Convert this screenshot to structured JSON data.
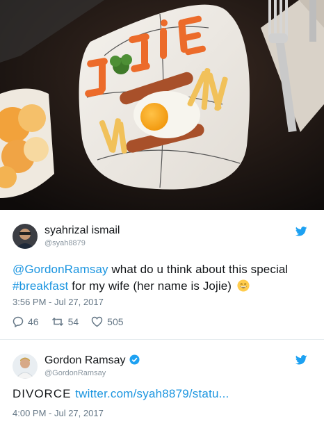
{
  "photo": {
    "plate_text": "Jojie",
    "description_icon": "breakfast-plate-photo"
  },
  "tweets": [
    {
      "author": {
        "name": "syahrizal ismail",
        "handle": "@syah8879",
        "verified": false
      },
      "text": {
        "mention": "@GordonRamsay",
        "part1": " what do u think about this special ",
        "hashtag": "#breakfast",
        "part2": " for my wife (her name is Jojie)",
        "emoji_icon": "grinning-face-emoji"
      },
      "timestamp": "3:56 PM - Jul 27, 2017",
      "actions": {
        "replies": "46",
        "retweets": "54",
        "likes": "505"
      }
    },
    {
      "author": {
        "name": "Gordon Ramsay",
        "handle": "@GordonRamsay",
        "verified": true
      },
      "text": {
        "plain": "DIVORCE ",
        "link": "twitter.com/syah8879/statu..."
      },
      "timestamp": "4:00 PM - Jul 27, 2017"
    }
  ],
  "colors": {
    "link": "#1b95e0",
    "twitter_blue": "#1da1f2",
    "muted": "#657786",
    "like_heart": "#657786"
  }
}
